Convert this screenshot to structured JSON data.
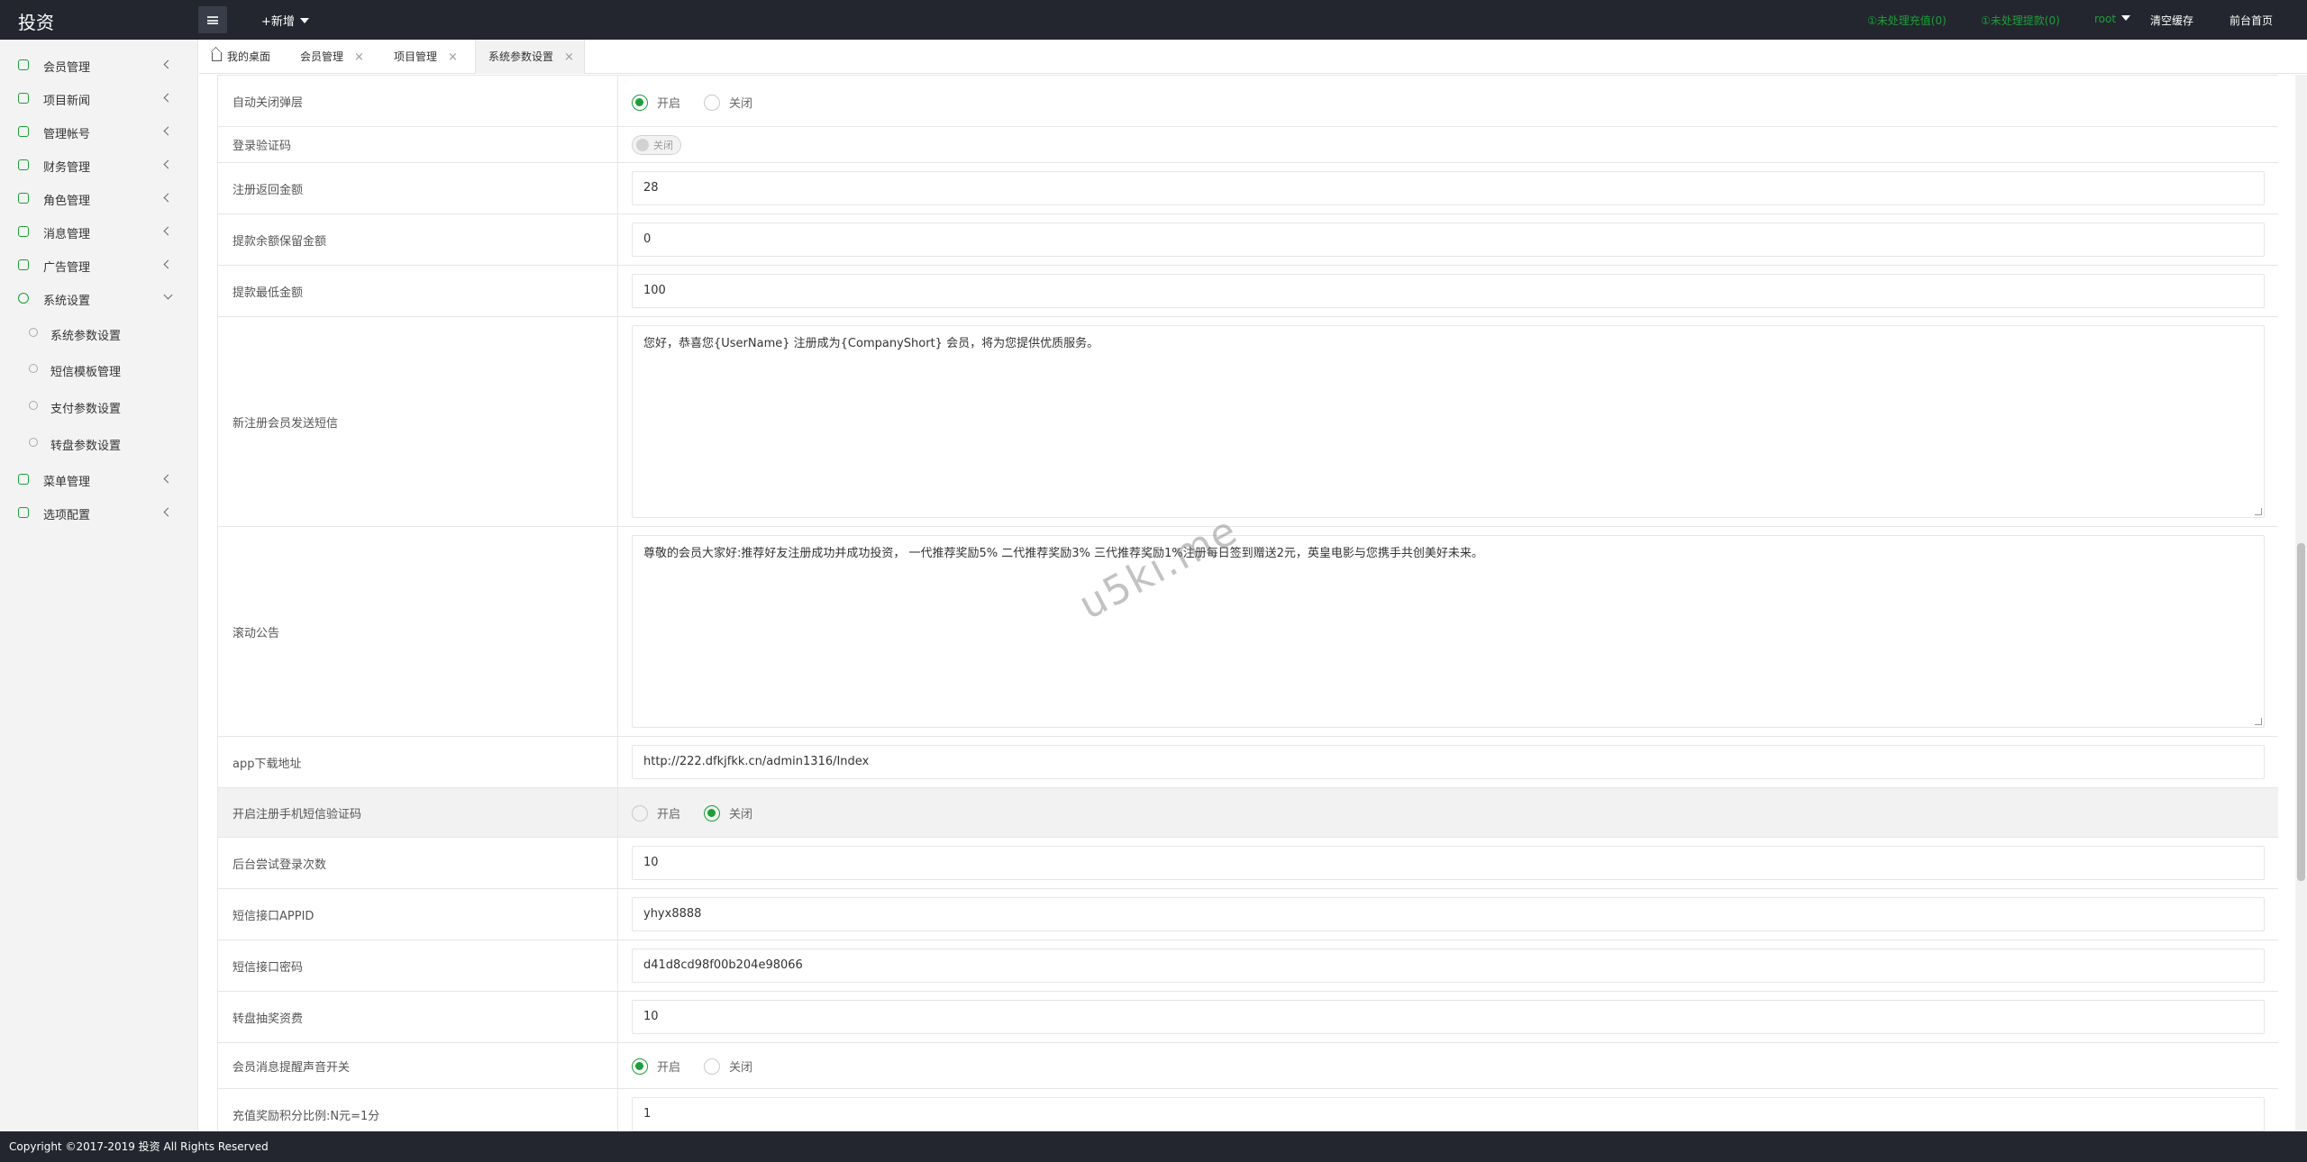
{
  "header": {
    "logo": "投资",
    "new_label": "+新增",
    "pending_recharge": "①未处理充值(0)",
    "pending_withdraw": "①未处理提款(0)",
    "user": "root",
    "clear_cache": "清空缓存",
    "front_home": "前台首页"
  },
  "sidebar": {
    "items": [
      {
        "label": "会员管理"
      },
      {
        "label": "项目新闻"
      },
      {
        "label": "管理帐号"
      },
      {
        "label": "财务管理"
      },
      {
        "label": "角色管理"
      },
      {
        "label": "消息管理"
      },
      {
        "label": "广告管理"
      },
      {
        "label": "系统设置"
      },
      {
        "label": "菜单管理"
      },
      {
        "label": "选项配置"
      }
    ],
    "sub_items": [
      {
        "label": "系统参数设置"
      },
      {
        "label": "短信模板管理"
      },
      {
        "label": "支付参数设置"
      },
      {
        "label": "转盘参数设置"
      }
    ]
  },
  "tabs": [
    {
      "label": "我的桌面"
    },
    {
      "label": "会员管理"
    },
    {
      "label": "项目管理"
    },
    {
      "label": "系统参数设置"
    }
  ],
  "form": {
    "auto_close": {
      "label": "自动关闭弹层",
      "on": "开启",
      "off": "关闭"
    },
    "login_captcha": {
      "label": "登录验证码",
      "switch": "关闭"
    },
    "register_bonus": {
      "label": "注册返回金额",
      "value": "28"
    },
    "withdraw_reserve": {
      "label": "提款余额保留金额",
      "value": "0"
    },
    "withdraw_min": {
      "label": "提款最低金额",
      "value": "100"
    },
    "new_member_sms": {
      "label": "新注册会员发送短信",
      "value": "您好，恭喜您{UserName} 注册成为{CompanyShort} 会员，将为您提供优质服务。"
    },
    "scroll_notice": {
      "label": "滚动公告",
      "value": "尊敬的会员大家好:推荐好友注册成功并成功投资， 一代推荐奖励5%  二代推荐奖励3%  三代推荐奖励1%注册每日签到赠送2元，英皇电影与您携手共创美好未来。"
    },
    "app_download": {
      "label": "app下载地址",
      "value": "http://222.dfkjfkk.cn/admin1316/Index"
    },
    "register_sms_verify": {
      "label": "开启注册手机短信验证码",
      "on": "开启",
      "off": "关闭"
    },
    "login_attempts": {
      "label": "后台尝试登录次数",
      "value": "10"
    },
    "sms_appid": {
      "label": "短信接口APPID",
      "value": "yhyx8888"
    },
    "sms_password": {
      "label": "短信接口密码",
      "value": "d41d8cd98f00b204e98066"
    },
    "lottery_fee": {
      "label": "转盘抽奖资费",
      "value": "10"
    },
    "msg_sound": {
      "label": "会员消息提醒声音开关",
      "on": "开启",
      "off": "关闭"
    },
    "recharge_points": {
      "label": "充值奖励积分比例:N元=1分",
      "value": "1"
    }
  },
  "watermark": "u5ki.me",
  "footer": "Copyright ©2017-2019 投资 All Rights Reserved",
  "colors": {
    "accent": "#1e9e3a",
    "header_bg": "#23262e"
  }
}
